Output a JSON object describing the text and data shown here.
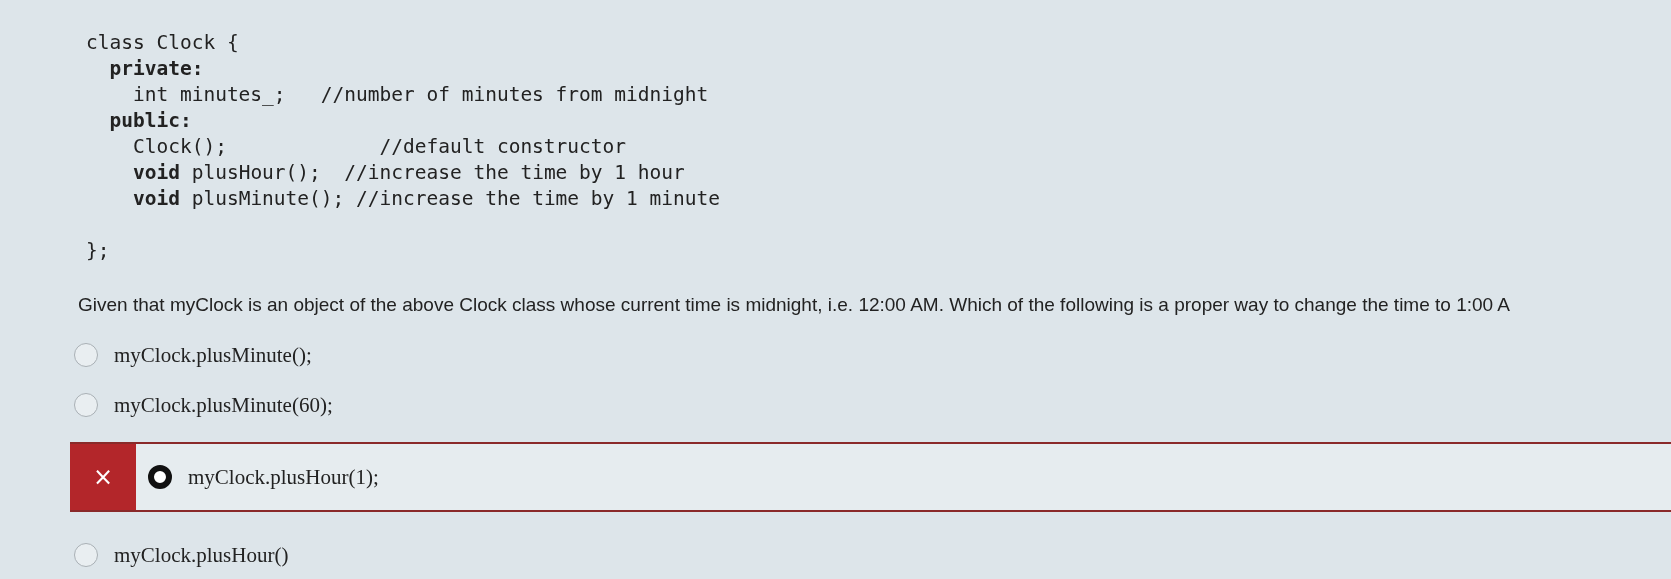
{
  "code_lines": [
    "class Clock {",
    "  **private:**",
    "    int minutes_;   //number of minutes from midnight",
    "  **public:**",
    "    Clock();             //default constructor",
    "    **void** plusHour();  //increase the time by 1 hour",
    "    **void** plusMinute(); //increase the time by 1 minute"
  ],
  "code_end": "};",
  "question": "Given that myClock is an object of the above Clock class whose current time is midnight, i.e. 12:00 AM. Which of the following is a proper way to change the time to 1:00 A",
  "options": [
    {
      "text": "myClock.plusMinute();",
      "selected": false,
      "incorrect": false
    },
    {
      "text": "myClock.plusMinute(60);",
      "selected": false,
      "incorrect": false
    },
    {
      "text": "myClock.plusHour(1);",
      "selected": true,
      "incorrect": true,
      "mark": "×"
    },
    {
      "text": "myClock.plusHour()",
      "selected": false,
      "incorrect": false
    }
  ]
}
